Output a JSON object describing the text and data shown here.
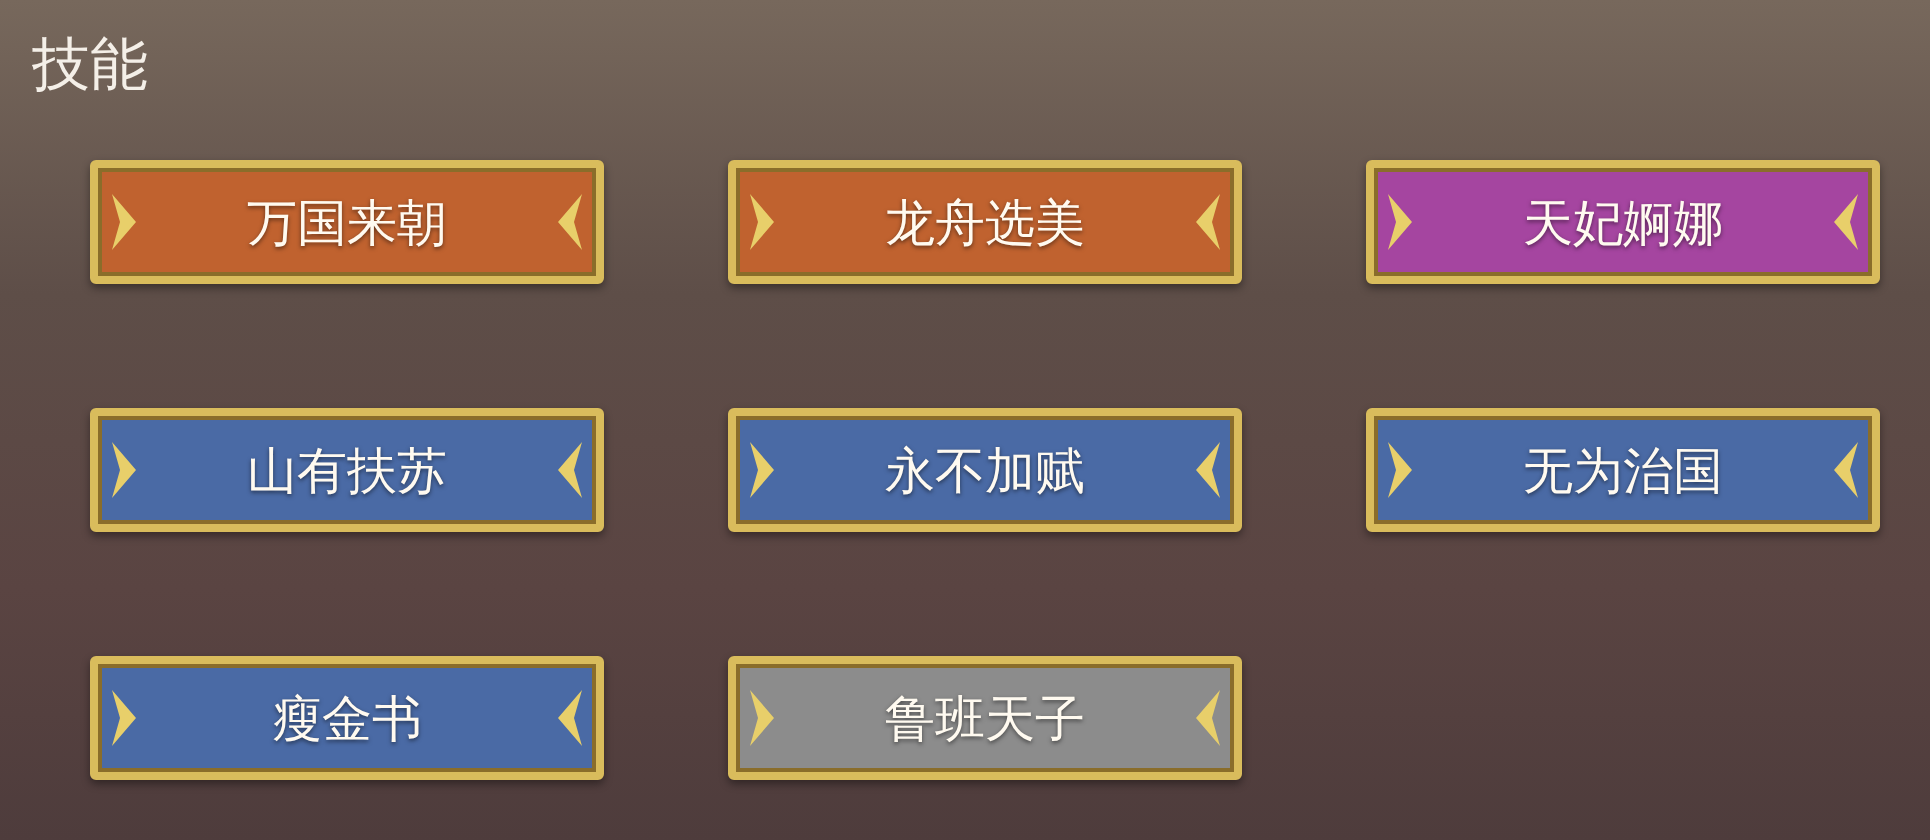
{
  "title": "技能",
  "skills": [
    {
      "label": "万国来朝",
      "color": "#c0622f"
    },
    {
      "label": "龙舟选美",
      "color": "#c0622f"
    },
    {
      "label": "天妃婀娜",
      "color": "#a545a0"
    },
    {
      "label": "山有扶苏",
      "color": "#4a6aa5"
    },
    {
      "label": "永不加赋",
      "color": "#4a6aa5"
    },
    {
      "label": "无为治国",
      "color": "#4a6aa5"
    },
    {
      "label": "瘦金书",
      "color": "#4a6aa5"
    },
    {
      "label": "鲁班天子",
      "color": "#8c8c8c"
    }
  ]
}
